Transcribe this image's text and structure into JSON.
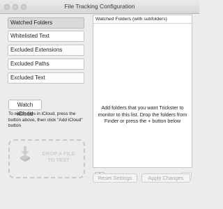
{
  "window": {
    "title": "File Tracking Configuration"
  },
  "sidebar": {
    "items": [
      {
        "label": "Watched Folders"
      },
      {
        "label": "Whitelisted Text"
      },
      {
        "label": "Excluded Extensions"
      },
      {
        "label": "Excluded Paths"
      },
      {
        "label": "Excluded Text"
      }
    ],
    "selected_index": 0
  },
  "icloud": {
    "button_label": "Watch iCloud",
    "help_text": "To watch files in iCloud, press the button above, then click \"Add iCloud\" button"
  },
  "dropzone": {
    "label_line1": "DROP A FILE",
    "label_line2": "TO TEST"
  },
  "list": {
    "header": "Watched Folders (with subfolders)",
    "empty_message": "Add folders that you want Trickster to monitor to this list. Drop the folders from Finder or press the + button below"
  },
  "controls": {
    "add_label": "+",
    "remove_label": "−"
  },
  "footer": {
    "reset_label": "Reset Settings",
    "apply_label": "Apply Changes"
  }
}
